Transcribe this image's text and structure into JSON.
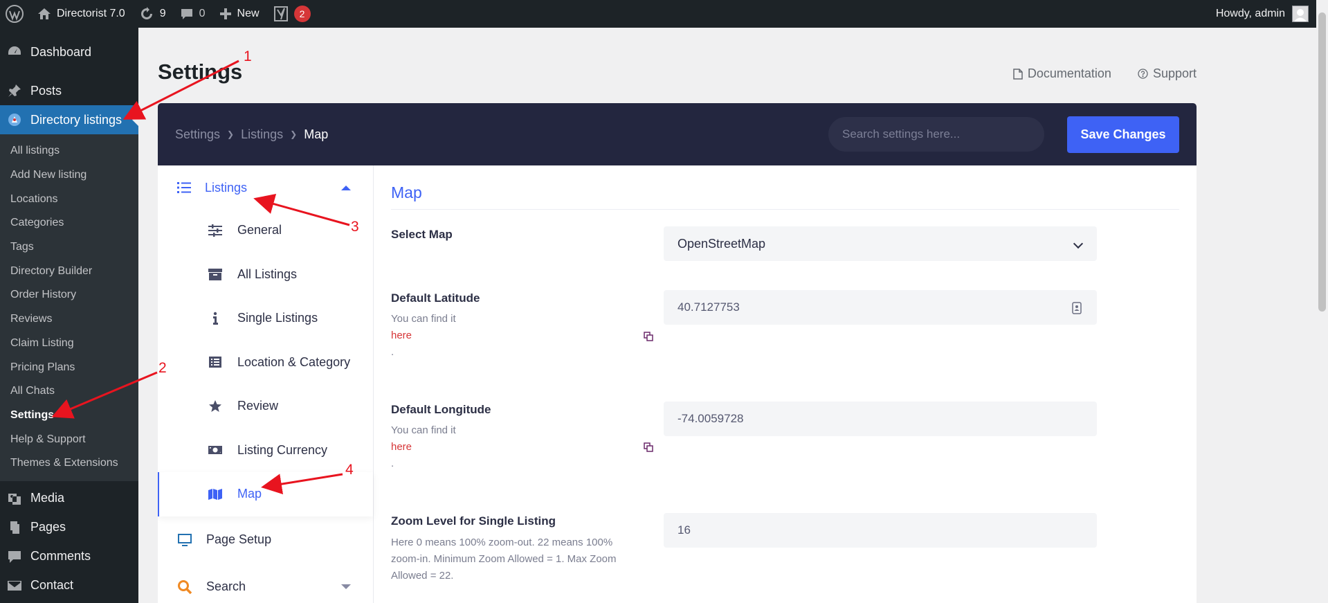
{
  "adminbar": {
    "site_name": "Directorist 7.0",
    "updates_count": "9",
    "comments_count": "0",
    "new_label": "New",
    "yoast_badge": "2",
    "howdy": "Howdy, admin"
  },
  "menu": {
    "dashboard": "Dashboard",
    "posts": "Posts",
    "directory_listings": "Directory listings",
    "submenu": [
      "All listings",
      "Add New listing",
      "Locations",
      "Categories",
      "Tags",
      "Directory Builder",
      "Order History",
      "Reviews",
      "Claim Listing",
      "Pricing Plans",
      "All Chats",
      "Settings",
      "Help & Support",
      "Themes & Extensions"
    ],
    "media": "Media",
    "pages": "Pages",
    "comments": "Comments",
    "contact": "Contact"
  },
  "page": {
    "title": "Settings",
    "documentation": "Documentation",
    "support": "Support"
  },
  "topbar": {
    "breadcrumb": [
      "Settings",
      "Listings",
      "Map"
    ],
    "search_placeholder": "Search settings here...",
    "save_label": "Save Changes"
  },
  "sidenav": {
    "listings": "Listings",
    "items": [
      "General",
      "All Listings",
      "Single Listings",
      "Location & Category",
      "Review",
      "Listing Currency",
      "Map"
    ],
    "page_setup": "Page Setup",
    "search": "Search"
  },
  "content": {
    "section_title": "Map",
    "select_map_label": "Select Map",
    "select_map_value": "OpenStreetMap",
    "latitude_label": "Default Latitude",
    "latitude_value": "40.7127753",
    "find_it": "You can find it",
    "here": "here",
    "dot": ".",
    "longitude_label": "Default Longitude",
    "longitude_value": "-74.0059728",
    "zoom_label": "Zoom Level for Single Listing",
    "zoom_desc": "Here 0 means 100% zoom-out. 22 means 100% zoom-in. Minimum Zoom Allowed = 1. Max Zoom Allowed = 22.",
    "zoom_value": "16"
  },
  "annotations": [
    "1",
    "2",
    "3",
    "4"
  ],
  "colors": {
    "accent": "#3e62f5",
    "admin_dark": "#1d2327",
    "wp_blue": "#2271b1",
    "annotation_red": "#e8141f"
  }
}
